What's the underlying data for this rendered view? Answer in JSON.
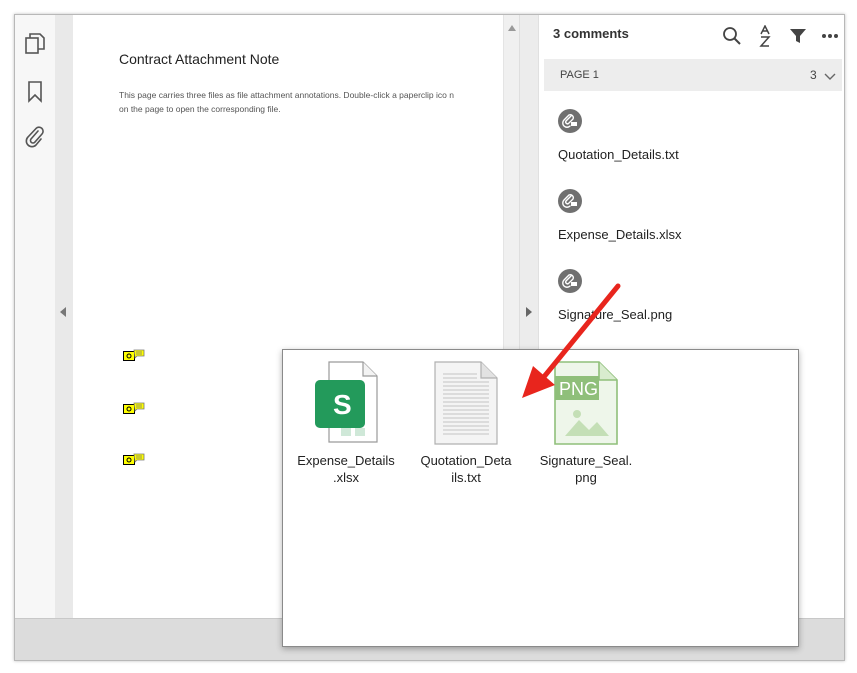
{
  "document": {
    "title": "Contract Attachment Note",
    "body": "This page carries three files as file attachment annotations. Double-click a paperclip ico n on the page to open the corresponding file."
  },
  "left_toolbar": {
    "icons": [
      "pages-icon",
      "bookmark-icon",
      "paperclip-icon"
    ]
  },
  "comments_panel": {
    "count_label": "3 comments",
    "page_label": "PAGE 1",
    "page_count": "3",
    "items": [
      {
        "name": "Quotation_Details.txt"
      },
      {
        "name": "Expense_Details.xlsx"
      },
      {
        "name": "Signature_Seal.png"
      }
    ],
    "header_icons": [
      "search-icon",
      "sort-az-icon",
      "filter-icon",
      "more-icon"
    ]
  },
  "explorer": {
    "files": [
      {
        "label": "Expense_Details\n.xlsx",
        "type": "xlsx",
        "glyph": "S"
      },
      {
        "label": "Quotation_Deta\nils.txt",
        "type": "txt"
      },
      {
        "label": "Signature_Seal.\npng",
        "type": "png",
        "glyph": "PNG"
      }
    ]
  },
  "colors": {
    "annotation_yellow": "#ffff00",
    "excel_green": "#1e8c4f",
    "png_green": "#8fbf7a",
    "arrow_red": "#e8251d"
  }
}
